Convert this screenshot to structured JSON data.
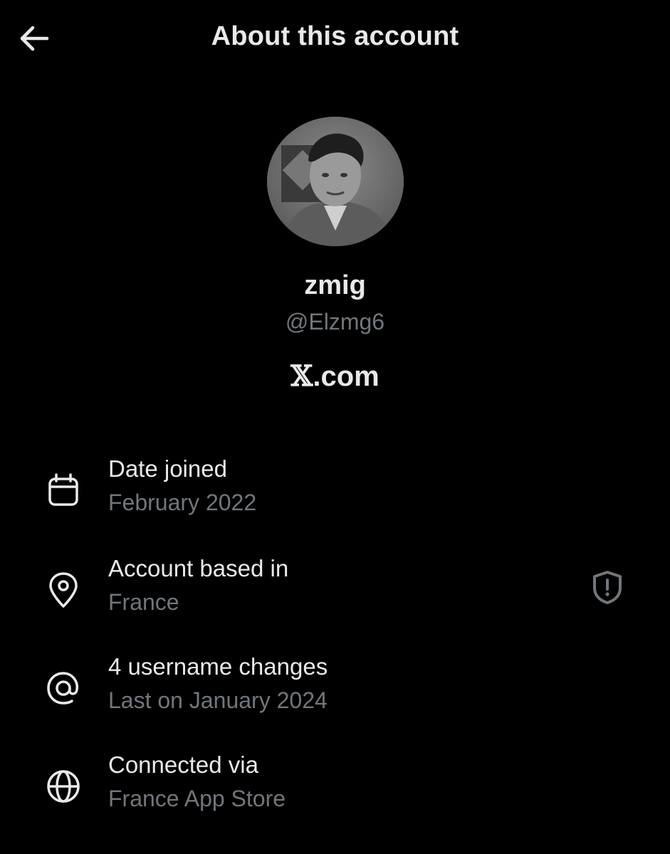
{
  "header": {
    "title": "About this account",
    "back_icon": "arrow-left-icon"
  },
  "profile": {
    "display_name": "zmig",
    "handle": "@Elzmg6",
    "domain_mark": "𝕏",
    "domain_suffix": ".com"
  },
  "details": [
    {
      "icon": "calendar-icon",
      "label": "Date joined",
      "value": "February 2022"
    },
    {
      "icon": "location-pin-icon",
      "label": "Account based in",
      "value": "France",
      "trailing_icon": "shield-alert-icon"
    },
    {
      "icon": "at-sign-icon",
      "label": "4 username changes",
      "value": "Last on January 2024"
    },
    {
      "icon": "globe-icon",
      "label": "Connected via",
      "value": "France App Store"
    }
  ],
  "colors": {
    "background": "#000000",
    "primary_text": "#e7e9ea",
    "secondary_text": "#71767b"
  }
}
